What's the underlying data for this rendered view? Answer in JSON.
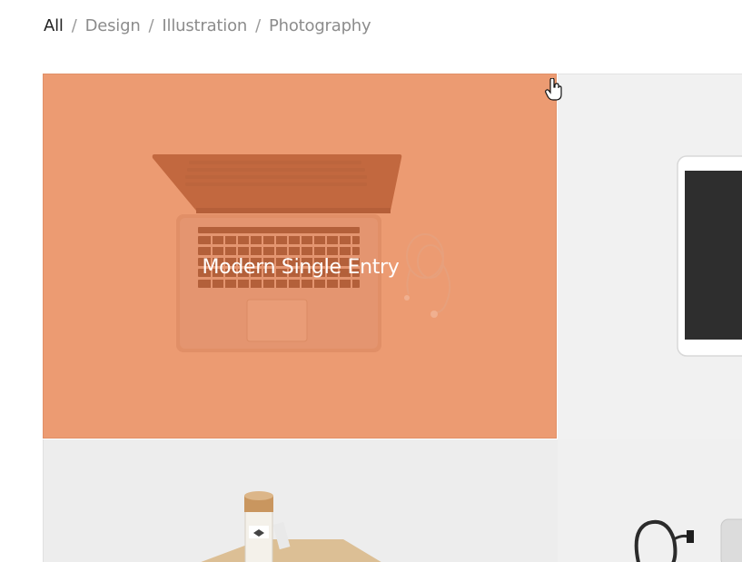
{
  "filters": {
    "items": [
      "All",
      "Design",
      "Illustration",
      "Photography"
    ],
    "active": "All",
    "separator": "/"
  },
  "portfolio": {
    "hover_title": "Modern Single Entry"
  },
  "colors": {
    "overlay": "#ec9b72",
    "active_filter": "#222222",
    "inactive_filter": "#8c8c8c"
  }
}
